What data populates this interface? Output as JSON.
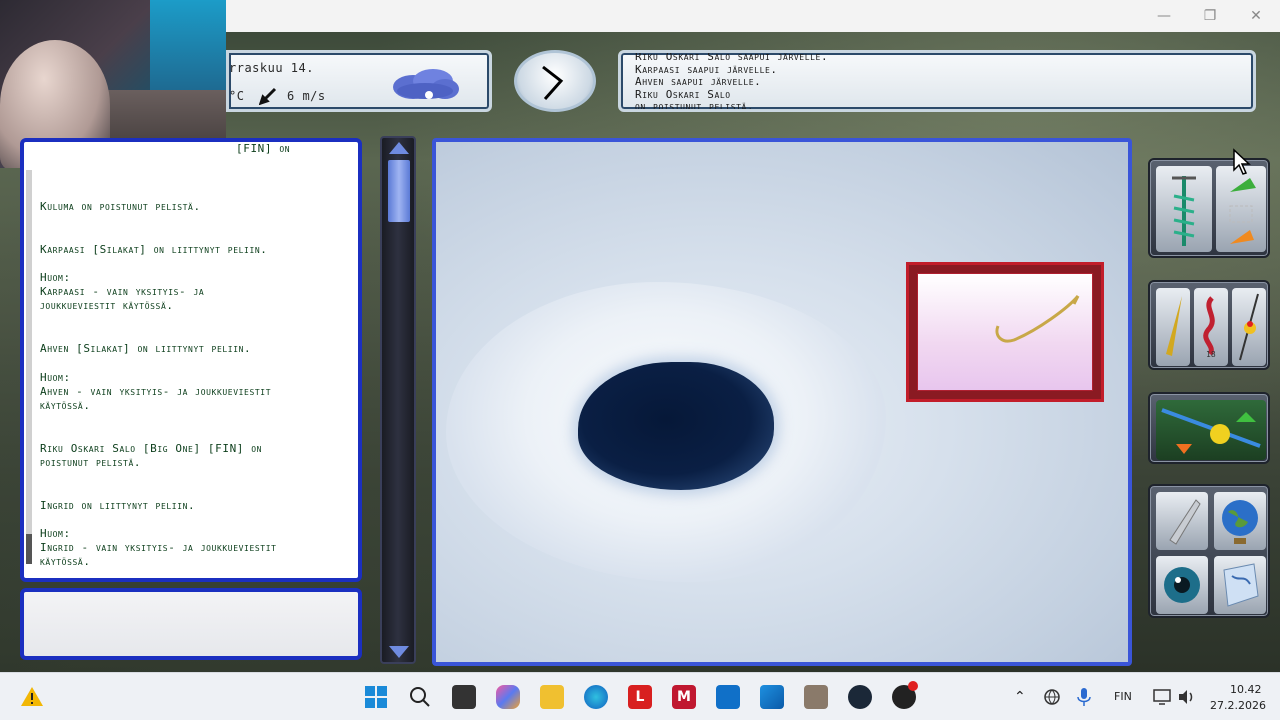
{
  "window": {
    "controls": {
      "minimize": "—",
      "maximize": "❐",
      "close": "✕"
    }
  },
  "hud": {
    "date_text": "rraskuu 14.",
    "temp_unit": "°C",
    "wind_text": "6 m/s",
    "weather_icon": "cloud-snow-icon"
  },
  "event_log": {
    "lines": [
      "Riku Oskari Salo saapui järvelle.",
      "Karpaasi saapui järvelle.",
      "Ahven saapui järvelle.",
      "Riku Oskari Salo",
      "on poistunut pelistä."
    ]
  },
  "chat": {
    "messages": [
      "[FIN] on",
      "Kuluma on poistunut pelistä.",
      "Karpaasi [Silakat] on liittynyt peliin.",
      "Huom:\nKarpaasi - vain yksityis- ja\njoukkueviestit käytössä.",
      "Ahven [Silakat] on liittynyt peliin.",
      "Huom:\nAhven - vain yksityis- ja joukkueviestit\nkäytössä.",
      "Riku Oskari Salo [Big One] [FIN] on\npoistunut pelistä.",
      "Ingrid on liittynyt peliin.",
      "Huom:\nIngrid - vain yksityis- ja joukkueviestit\nkäytössä."
    ]
  },
  "tools": {
    "items": [
      "ice-drill-icon",
      "move-icon",
      "lure-gold-icon",
      "worm-bait-icon",
      "rod-float-icon",
      "rod-reel-icon",
      "knife-icon",
      "globe-icon",
      "eye-icon",
      "map-icon"
    ],
    "worm_count": "18"
  },
  "taskbar": {
    "language": "FIN",
    "time": "10.42",
    "date": "27.2.2026",
    "apps": [
      "start",
      "search",
      "files",
      "copilot",
      "explorer",
      "edge",
      "l-app",
      "mcafee",
      "outlook",
      "store",
      "fishing-game",
      "steam",
      "media"
    ]
  }
}
